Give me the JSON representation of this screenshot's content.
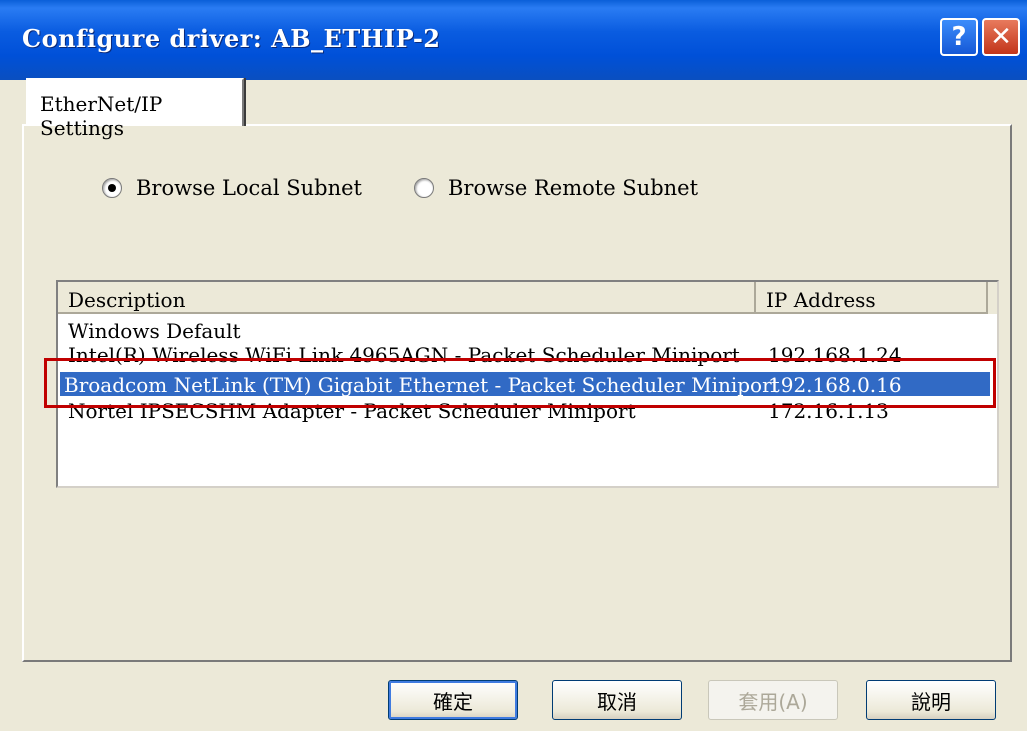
{
  "window": {
    "title": "Configure driver: AB_ETHIP-2",
    "help_label": "?",
    "close_label": "✕"
  },
  "tabs": [
    {
      "label": "EtherNet/IP Settings",
      "active": true
    }
  ],
  "browse": {
    "local": {
      "label": "Browse Local Subnet",
      "checked": true
    },
    "remote": {
      "label": "Browse Remote Subnet",
      "checked": false
    }
  },
  "list": {
    "columns": [
      "Description",
      "IP Address"
    ],
    "rows": [
      {
        "description": "Windows Default",
        "ip": ""
      },
      {
        "description": "Intel(R) Wireless WiFi Link 4965AGN - Packet Scheduler Miniport",
        "ip": "192.168.1.24"
      },
      {
        "description": "Broadcom NetLink (TM) Gigabit Ethernet - Packet Scheduler Miniport",
        "ip": "192.168.0.16",
        "selected": true
      },
      {
        "description": "Nortel IPSECSHM Adapter - Packet Scheduler Miniport",
        "ip": "172.16.1.13"
      }
    ]
  },
  "buttons": {
    "ok": "確定",
    "cancel": "取消",
    "apply": "套用(A)",
    "help": "說明"
  },
  "colors": {
    "selection": "#316ac5",
    "highlight_box": "#c00000"
  }
}
